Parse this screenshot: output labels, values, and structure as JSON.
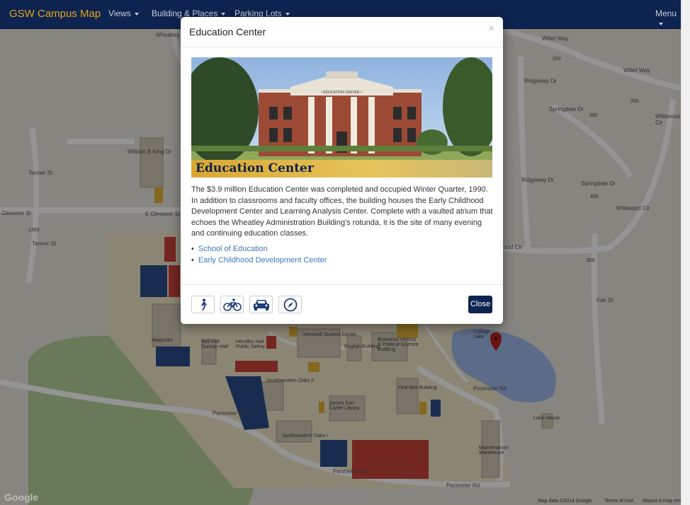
{
  "navbar": {
    "brand": "GSW Campus Map",
    "items": [
      {
        "label": "Views"
      },
      {
        "label": "Building & Places"
      },
      {
        "label": "Parking Lots"
      }
    ],
    "menu": "Menu"
  },
  "map": {
    "street_labels": [
      "Willet Way",
      "Willet Way",
      "Springdale Dr",
      "Springdale Dr",
      "Ridgeway Dr",
      "Ridgeway Dr",
      "Wildwood Cir",
      "Wildwood Cir",
      "Fair St",
      "Tanner St",
      "Tanner St",
      "Glessner St",
      "E Glessner St",
      "William B King Dr",
      "Perimeter Rd",
      "Perimeter Rd",
      "Perimeter Rd",
      "Perimeter Rd",
      "Wheatley",
      "ood Cir"
    ],
    "place_labels": [
      "Marshall Student Center",
      "English Building",
      "Business/ History & Political Science Building",
      "Southwestern Oaks II",
      "James Earl Carter Library",
      "Fine Arts Building",
      "Southwestern Oaks I",
      "Bell Hall Duncan Hall",
      "Hendley Hall Public Safety",
      "Magnolia",
      "Maintenance/ Warehouse",
      "Lake House",
      "College Lake"
    ],
    "numbers": [
      "200",
      "200",
      "300",
      "400",
      "500",
      "1300"
    ],
    "google": "Google",
    "footer": {
      "data": "Map data ©2014 Google",
      "terms": "Terms of Use",
      "report": "Report a map error"
    }
  },
  "modal": {
    "title": "Education Center",
    "close_x": "×",
    "hero_caption": "Education Center",
    "building_sign": "• EDUCATION CENTER •",
    "description": "The $3.9 million Education Center was completed and occupied Winter Quarter, 1990. In addition to classrooms and faculty offices, the building houses the Early Childhood Development Center and Learning Analysis Center. Complete with a vaulted atrium that echoes the Wheatley Administration Building's rotunda, it is the site of many evening and continuing education classes.",
    "links": [
      {
        "label": "School of Education"
      },
      {
        "label": "Early Childhood Development Center"
      }
    ],
    "travel_modes": [
      {
        "icon": "walk-icon"
      },
      {
        "icon": "bicycle-icon"
      },
      {
        "icon": "car-icon"
      },
      {
        "icon": "compass-icon"
      }
    ],
    "close_button": "Close"
  },
  "colors": {
    "navbar_bg": "#0d2450",
    "brand": "#e6a21d",
    "link": "#3a78b8",
    "close_button": "#0d2450",
    "parking_blue": "#2c4d8a",
    "parking_red": "#c9433a",
    "marker": "#b8231c"
  }
}
